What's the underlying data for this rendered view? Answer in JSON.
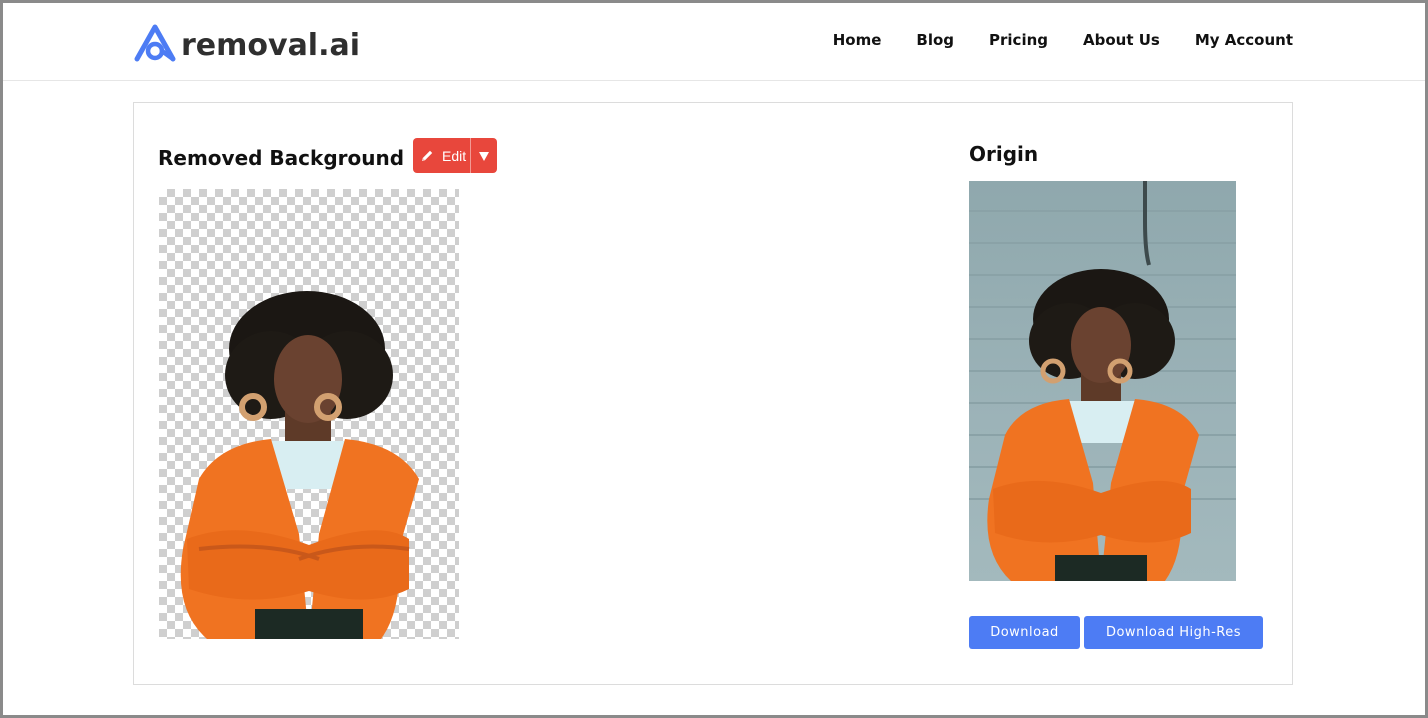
{
  "brand": {
    "name": "removal.ai",
    "accent": "#4d7cf4"
  },
  "nav": {
    "items": [
      {
        "label": "Home"
      },
      {
        "label": "Blog"
      },
      {
        "label": "Pricing"
      },
      {
        "label": "About Us"
      },
      {
        "label": "My Account"
      }
    ]
  },
  "result": {
    "title": "Removed Background",
    "edit_label": "Edit",
    "edit_color": "#e8473c"
  },
  "origin": {
    "title": "Origin"
  },
  "downloads": {
    "download_label": "Download",
    "download_hires_label": "Download High-Res"
  }
}
